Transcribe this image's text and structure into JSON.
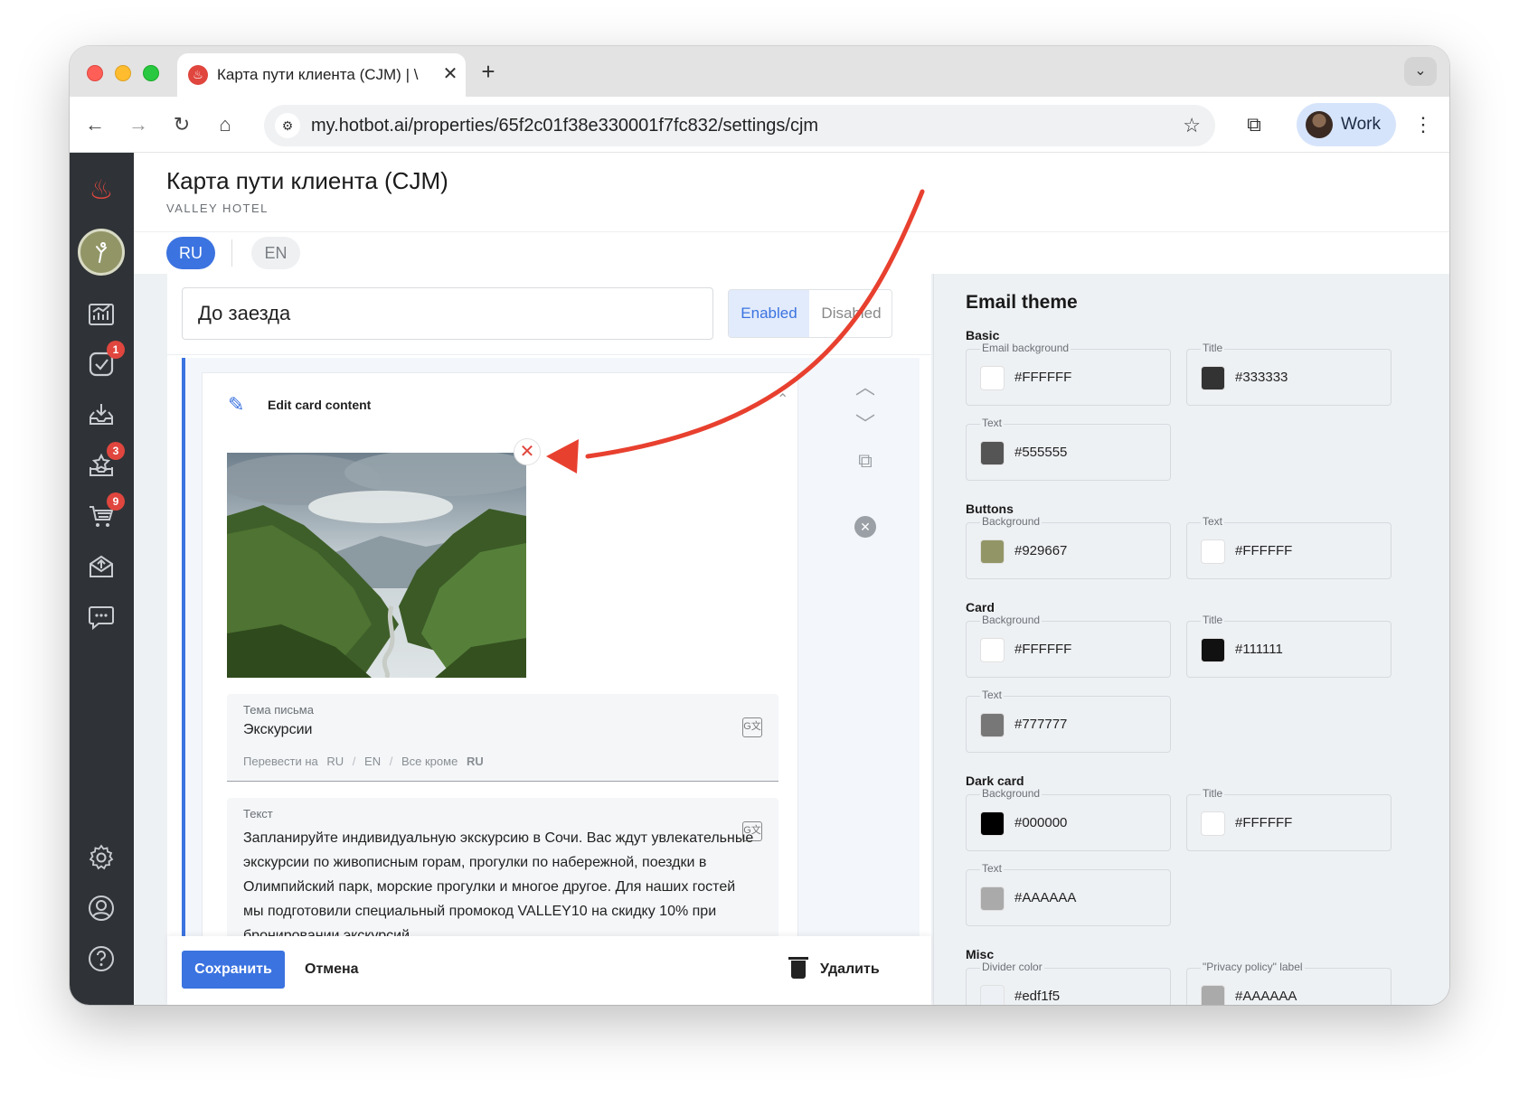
{
  "browser": {
    "tab_title": "Карта пути клиента (CJM) | \\",
    "tab_favicon": "♨",
    "url": "my.hotbot.ai/properties/65f2c01f38e330001f7fc832/settings/cjm",
    "profile_label": "Work"
  },
  "sidebar": {
    "badges": {
      "tasks": "1",
      "inbox": "3",
      "cart": "9"
    }
  },
  "header": {
    "title": "Карта пути клиента (CJM)",
    "subtitle": "VALLEY HOTEL"
  },
  "languages": {
    "ru": "RU",
    "en": "EN"
  },
  "stage": {
    "name": "До заезда",
    "enabled_label": "Enabled",
    "disabled_label": "Disabled"
  },
  "card": {
    "edit_label": "Edit card content",
    "subject_label": "Тема письма",
    "subject_value": "Экскурсии",
    "translate_prefix": "Перевести на",
    "translate_ru": "RU",
    "translate_en": "EN",
    "translate_all_prefix": "Все кроме",
    "translate_all_lang": "RU",
    "text_label": "Текст",
    "text_value": "Запланируйте индивидуальную экскурсию в Сочи. Вас ждут увлекательные экскурсии по живописным горам, прогулки по набережной, поездки в Олимпийский парк, морские прогулки и многое другое. Для наших гостей мы подготовили специальный промокод VALLEY10 на скидку 10% при бронировании экскурсий."
  },
  "actions": {
    "save": "Сохранить",
    "cancel": "Отмена",
    "delete": "Удалить"
  },
  "theme": {
    "title": "Email theme",
    "basic": {
      "title": "Basic",
      "email_background": {
        "label": "Email background",
        "value": "#FFFFFF"
      },
      "title_color": {
        "label": "Title",
        "value": "#333333"
      },
      "text": {
        "label": "Text",
        "value": "#555555"
      }
    },
    "buttons": {
      "title": "Buttons",
      "background": {
        "label": "Background",
        "value": "#929667"
      },
      "text": {
        "label": "Text",
        "value": "#FFFFFF"
      }
    },
    "card": {
      "title": "Card",
      "background": {
        "label": "Background",
        "value": "#FFFFFF"
      },
      "title_color": {
        "label": "Title",
        "value": "#111111"
      },
      "text": {
        "label": "Text",
        "value": "#777777"
      }
    },
    "dark_card": {
      "title": "Dark card",
      "background": {
        "label": "Background",
        "value": "#000000"
      },
      "title_color": {
        "label": "Title",
        "value": "#FFFFFF"
      },
      "text": {
        "label": "Text",
        "value": "#AAAAAA"
      }
    },
    "misc": {
      "title": "Misc",
      "divider": {
        "label": "Divider color",
        "value": "#edf1f5"
      },
      "privacy": {
        "label": "\"Privacy policy\" label",
        "value": "#AAAAAA"
      }
    }
  },
  "colors": {
    "accent": "#3b73e0",
    "brand": "#929667",
    "annotation": "#e8402f"
  }
}
